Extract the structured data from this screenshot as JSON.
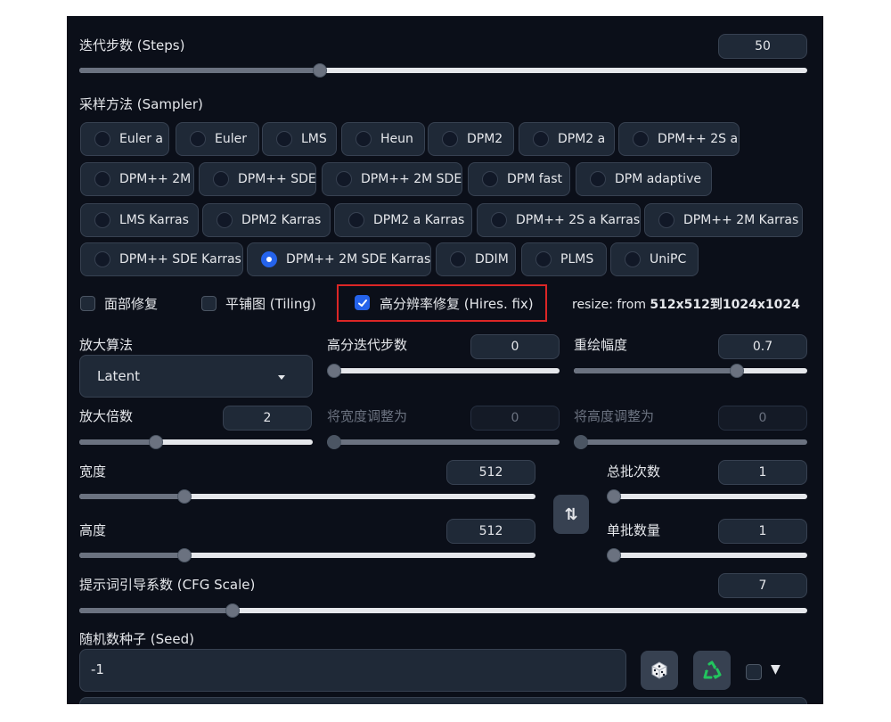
{
  "steps": {
    "label": "迭代步数 (Steps)",
    "value": "50",
    "fraction": 0.33
  },
  "sampler": {
    "label": "采样方法 (Sampler)",
    "options": [
      "Euler a",
      "Euler",
      "LMS",
      "Heun",
      "DPM2",
      "DPM2 a",
      "DPM++ 2S a",
      "DPM++ 2M",
      "DPM++ SDE",
      "DPM++ 2M SDE",
      "DPM fast",
      "DPM adaptive",
      "LMS Karras",
      "DPM2 Karras",
      "DPM2 a Karras",
      "DPM++ 2S a Karras",
      "DPM++ 2M Karras",
      "DPM++ SDE Karras",
      "DPM++ 2M SDE Karras",
      "DDIM",
      "PLMS",
      "UniPC"
    ],
    "selected": "DPM++ 2M SDE Karras"
  },
  "checks": {
    "face_restore": {
      "label": "面部修复",
      "checked": false
    },
    "tiling": {
      "label": "平铺图 (Tiling)",
      "checked": false
    },
    "hires_fix": {
      "label": "高分辨率修复 (Hires. fix)",
      "checked": true
    }
  },
  "resize": {
    "prefix": "resize: from ",
    "value": "512x512到1024x1024"
  },
  "upscaler": {
    "label": "放大算法",
    "value": "Latent"
  },
  "hires_steps": {
    "label": "高分迭代步数",
    "value": "0",
    "fraction": 0.0
  },
  "denoise": {
    "label": "重绘幅度",
    "value": "0.7",
    "fraction": 0.7
  },
  "upscale_by": {
    "label": "放大倍数",
    "value": "2",
    "fraction": 0.33
  },
  "resize_width": {
    "label": "将宽度调整为",
    "value": "0",
    "fraction": 0.0
  },
  "resize_height": {
    "label": "将高度调整为",
    "value": "0",
    "fraction": 0.0
  },
  "width": {
    "label": "宽度",
    "value": "512",
    "fraction": 0.23
  },
  "height": {
    "label": "高度",
    "value": "512",
    "fraction": 0.23
  },
  "batch_count": {
    "label": "总批次数",
    "value": "1",
    "fraction": 0.0
  },
  "batch_size": {
    "label": "单批数量",
    "value": "1",
    "fraction": 0.0
  },
  "swap_icon": "⇅",
  "cfg": {
    "label": "提示词引导系数 (CFG Scale)",
    "value": "7",
    "fraction": 0.21
  },
  "seed": {
    "label": "随机数种子 (Seed)",
    "value": "-1",
    "extra_arrow": "▼"
  },
  "colors": {
    "accent": "#2563eb",
    "highlight_border": "#dc2626",
    "panel_bg": "#0b0f19"
  }
}
